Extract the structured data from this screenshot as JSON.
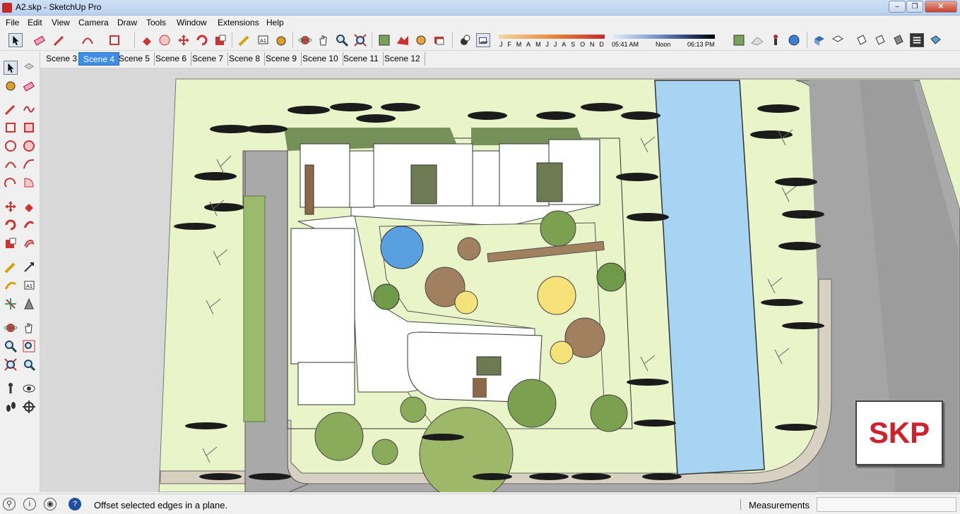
{
  "window": {
    "title": "A2.skp - SketchUp Pro",
    "min": "–",
    "max": "❐",
    "close": "✕"
  },
  "menu": [
    "File",
    "Edit",
    "View",
    "Camera",
    "Draw",
    "Tools",
    "Window",
    "Extensions",
    "Help"
  ],
  "toolbar": {
    "icons": [
      "select-icon",
      "eraser-icon",
      "pencil-icon",
      "arc-icon",
      "rectangle-icon",
      "push-pull-icon",
      "follow-me-icon",
      "move-icon",
      "rotate-icon",
      "scale-icon",
      "tape-measure-icon",
      "text-icon",
      "paint-bucket-icon",
      "orbit-icon",
      "pan-icon",
      "zoom-icon",
      "zoom-extents-icon",
      "add-location-icon",
      "geo-terrain-icon",
      "photo-texture-icon",
      "3d-warehouse-icon",
      "shadows-toggle-icon",
      "shadow-display-icon"
    ],
    "shadow_months": [
      "J",
      "F",
      "M",
      "A",
      "M",
      "J",
      "J",
      "A",
      "S",
      "O",
      "N",
      "D"
    ],
    "sunrise": "05:41 AM",
    "noon": "Noon",
    "sunset": "06:13 PM"
  },
  "scenes": [
    "Scene 3",
    "Scene 4",
    "Scene 5",
    "Scene 6",
    "Scene 7",
    "Scene 8",
    "Scene 9",
    "Scene 10",
    "Scene 11",
    "Scene 12"
  ],
  "active_scene": "Scene 4",
  "status": {
    "message": "Offset selected edges in a plane.",
    "measurements_label": "Measurements",
    "measurements_value": ""
  },
  "badge": "SKP",
  "colors": {
    "grass": "#e9f5c9",
    "water": "#a7d4f2",
    "road": "#a9a9a9",
    "building": "#ffffff",
    "accent_tab": "#3e8ee8"
  }
}
